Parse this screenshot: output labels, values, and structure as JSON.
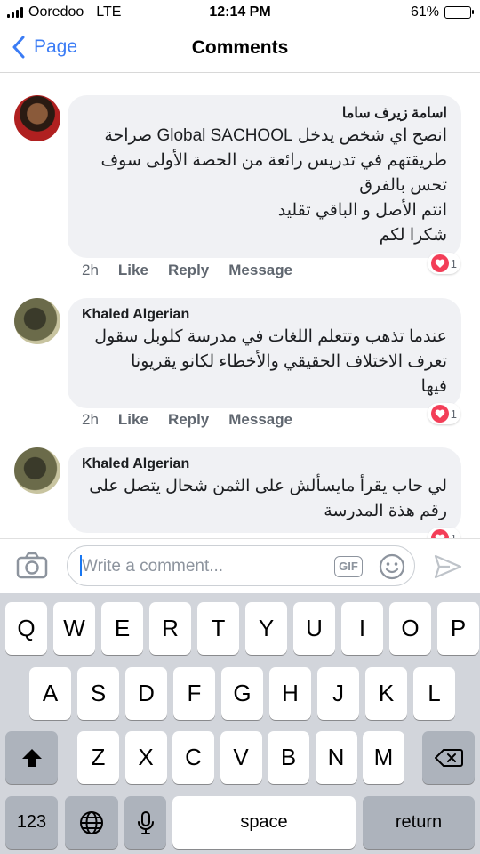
{
  "status_bar": {
    "carrier": "Ooredoo",
    "network": "LTE",
    "time": "12:14 PM",
    "battery": "61%",
    "battery_level": 0.61
  },
  "nav": {
    "back_label": "Page",
    "title": "Comments"
  },
  "comments": [
    {
      "author": "اسامة زيرف ساما",
      "lines": [
        "انصح اي شخص يدخل Global SACHOOL صراحة",
        "طريقتهم في تدريس رائعة من الحصة الأولى سوف",
        "تحس بالفرق",
        "انتم الأصل و الباقي تقليد",
        "شكرا لكم"
      ],
      "time": "2h",
      "like": "Like",
      "reply": "Reply",
      "message": "Message",
      "reactions": "1"
    },
    {
      "author": "Khaled Algerian",
      "lines": [
        "عندما تذهب وتتعلم اللغات في مدرسة كلوبل سقول",
        "تعرف الاختلاف الحقيقي والأخطاء  لكانو يقريونا",
        "فيها"
      ],
      "time": "2h",
      "like": "Like",
      "reply": "Reply",
      "message": "Message",
      "reactions": "1"
    },
    {
      "author": "Khaled Algerian",
      "lines": [
        "لي حاب يقرأ مايسألش على الثمن شحال يتصل على",
        "رقم هذة المدرسة"
      ],
      "reactions": "1"
    }
  ],
  "composer": {
    "placeholder": "Write a comment...",
    "gif_label": "GIF"
  },
  "keyboard": {
    "row1": [
      "Q",
      "W",
      "E",
      "R",
      "T",
      "Y",
      "U",
      "I",
      "O",
      "P"
    ],
    "row2": [
      "A",
      "S",
      "D",
      "F",
      "G",
      "H",
      "J",
      "K",
      "L"
    ],
    "row3": [
      "Z",
      "X",
      "C",
      "V",
      "B",
      "N",
      "M"
    ],
    "numbers_label": "123",
    "space_label": "space",
    "return_label": "return"
  },
  "colors": {
    "accent": "#3b7cf5",
    "bubble": "#f0f1f4",
    "heart": "#f33e58",
    "keyboard_bg": "#d2d5db"
  }
}
